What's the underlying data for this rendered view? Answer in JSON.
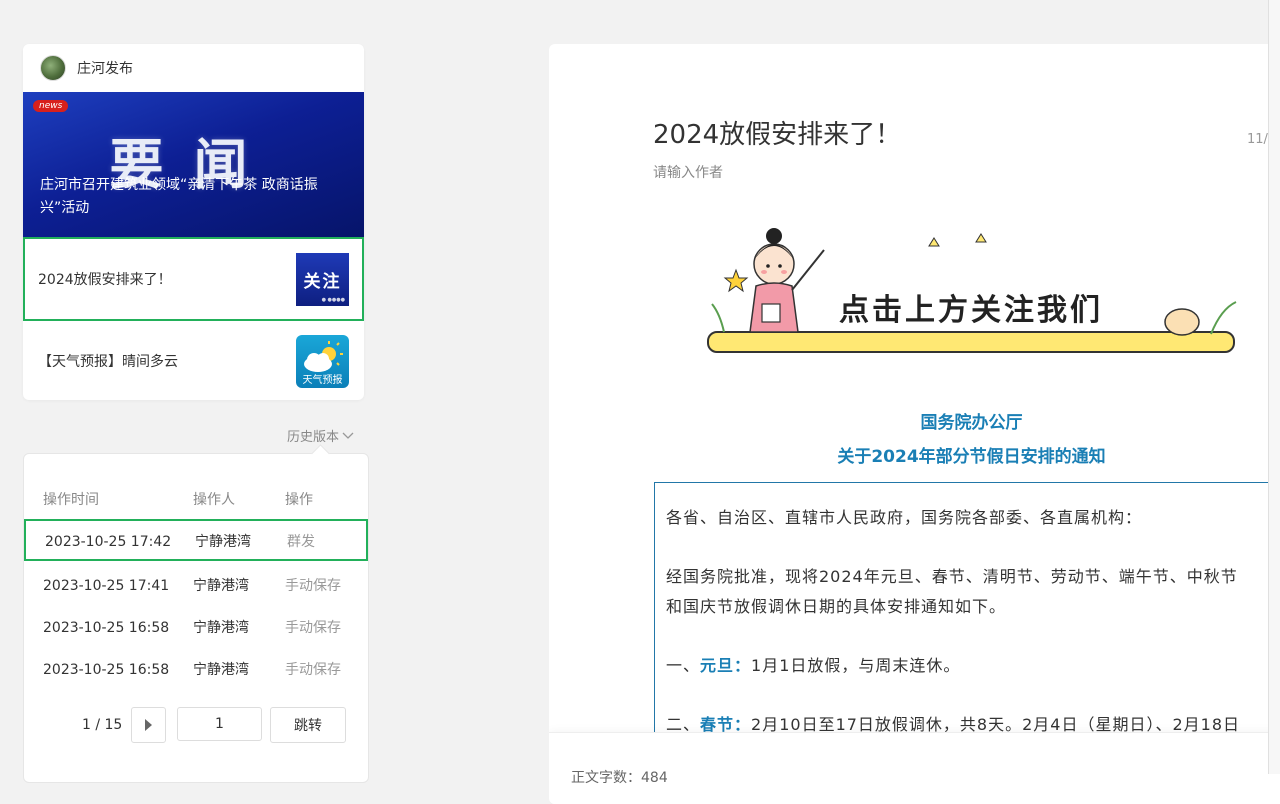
{
  "account": {
    "name": "庄河发布"
  },
  "articles": {
    "lead": {
      "tag": "news",
      "banner_word": "要闻",
      "title": "庄河市召开建筑业领域“亲清下午茶 政商话振兴”活动"
    },
    "items": [
      {
        "title": "2024放假安排来了！",
        "thumb_text": "关注",
        "thumb_small": "● ●●●●",
        "selected": true
      },
      {
        "title": "【天气预报】晴间多云",
        "thumb_text": "天气预报",
        "selected": false
      }
    ]
  },
  "history": {
    "toggle_label": "历史版本",
    "columns": [
      "操作时间",
      "操作人",
      "操作"
    ],
    "rows": [
      {
        "time": "2023-10-25 17:42",
        "operator": "宁静港湾",
        "action": "群发",
        "selected": true
      },
      {
        "time": "2023-10-25 17:41",
        "operator": "宁静港湾",
        "action": "手动保存"
      },
      {
        "time": "2023-10-25 16:58",
        "operator": "宁静港湾",
        "action": "手动保存"
      },
      {
        "time": "2023-10-25 16:58",
        "operator": "宁静港湾",
        "action": "手动保存"
      }
    ],
    "pager": {
      "page_count": "1 / 15",
      "input_value": "1",
      "jump_label": "跳转"
    }
  },
  "article": {
    "title": "2024放假安排来了！",
    "date": "11/",
    "author_placeholder": "请输入作者",
    "banner_text": "点击上方关注我们",
    "notice_org": "国务院办公厅",
    "notice_title": "关于2024年部分节假日安排的通知",
    "paragraphs": {
      "p1": "各省、自治区、直辖市人民政府，国务院各部委、各直属机构：",
      "p2a": "经国务院批准，现将2024年元旦、春节、清明节、劳动节、端午节、中秋节",
      "p2b": "和国庆节放假调休日期的具体安排通知如下。",
      "p3_prefix": "一、",
      "p3_key": "元旦：",
      "p3_text": "1月1日放假，与周末连休。",
      "p4_prefix": "二、",
      "p4_key": "春节：",
      "p4_text": "2月10日至17日放假调休，共8天。2月4日（星期日）、2月18日"
    },
    "footer_wordcount": "正文字数：484"
  },
  "colors": {
    "accent_green": "#22b05a",
    "link_blue": "#1a7fb5",
    "border_blue": "#2277a8"
  }
}
